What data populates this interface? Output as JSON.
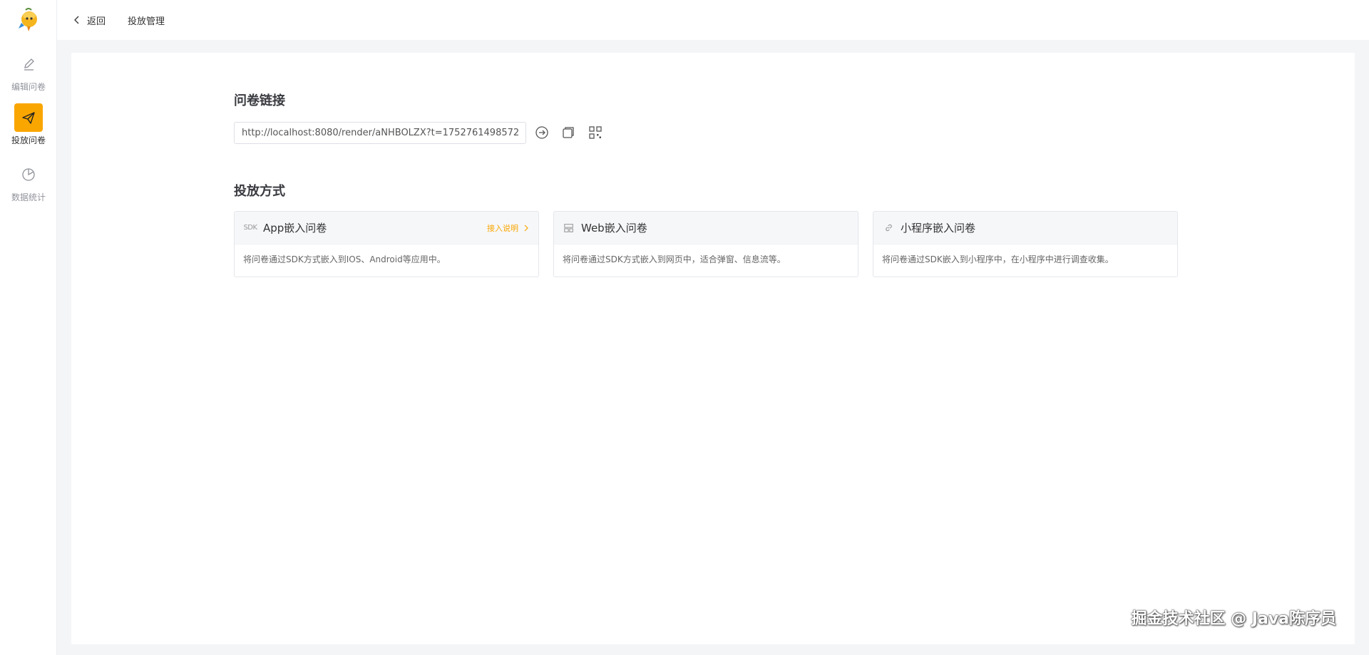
{
  "sidebar": {
    "items": [
      {
        "label": "编辑问卷",
        "icon": "edit-icon",
        "active": false
      },
      {
        "label": "投放问卷",
        "icon": "send-icon",
        "active": true
      },
      {
        "label": "数据统计",
        "icon": "pie-chart-icon",
        "active": false
      }
    ],
    "accent_color": "#faa600"
  },
  "header": {
    "back_label": "返回",
    "title": "投放管理"
  },
  "link_section": {
    "title": "问卷链接",
    "url": "http://localhost:8080/render/aNHBOLZX?t=1752761498572"
  },
  "delivery_section": {
    "title": "投放方式",
    "cards": [
      {
        "icon_text": "SDK",
        "title": "App嵌入问卷",
        "link": "接入说明",
        "desc": "将问卷通过SDK方式嵌入到IOS、Android等应用中。"
      },
      {
        "icon": "web-icon",
        "title": "Web嵌入问卷",
        "desc": "将问卷通过SDK方式嵌入到网页中，适合弹窗、信息流等。"
      },
      {
        "icon": "link-icon",
        "title": "小程序嵌入问卷",
        "desc": "将问卷通过SDK嵌入到小程序中，在小程序中进行调查收集。"
      }
    ]
  },
  "watermark": "掘金技术社区 @ Java陈序员"
}
